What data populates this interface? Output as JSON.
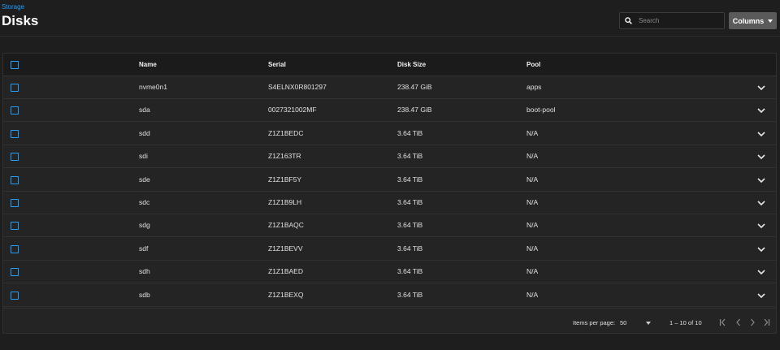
{
  "breadcrumb": "Storage",
  "title": "Disks",
  "search": {
    "placeholder": "Search",
    "value": ""
  },
  "columns_button": {
    "label": "Columns"
  },
  "table": {
    "headers": [
      "Name",
      "Serial",
      "Disk Size",
      "Pool"
    ],
    "rows": [
      {
        "name": "nvme0n1",
        "serial": "S4ELNX0R801297",
        "size": "238.47 GiB",
        "pool": "apps"
      },
      {
        "name": "sda",
        "serial": "0027321002MF",
        "size": "238.47 GiB",
        "pool": "boot-pool"
      },
      {
        "name": "sdd",
        "serial": "Z1Z1BEDC",
        "size": "3.64 TiB",
        "pool": "N/A"
      },
      {
        "name": "sdi",
        "serial": "Z1Z163TR",
        "size": "3.64 TiB",
        "pool": "N/A"
      },
      {
        "name": "sde",
        "serial": "Z1Z1BF5Y",
        "size": "3.64 TiB",
        "pool": "N/A"
      },
      {
        "name": "sdc",
        "serial": "Z1Z1B9LH",
        "size": "3.64 TiB",
        "pool": "N/A"
      },
      {
        "name": "sdg",
        "serial": "Z1Z1BAQC",
        "size": "3.64 TiB",
        "pool": "N/A"
      },
      {
        "name": "sdf",
        "serial": "Z1Z1BEVV",
        "size": "3.64 TiB",
        "pool": "N/A"
      },
      {
        "name": "sdh",
        "serial": "Z1Z1BAED",
        "size": "3.64 TiB",
        "pool": "N/A"
      },
      {
        "name": "sdb",
        "serial": "Z1Z1BEXQ",
        "size": "3.64 TiB",
        "pool": "N/A"
      }
    ]
  },
  "paginator": {
    "items_per_page_label": "Items per page:",
    "items_per_page": "50",
    "range": "1 – 10 of 10"
  },
  "colors": {
    "accent": "#1f9fff",
    "background": "#1e1e1e",
    "card": "#242424"
  }
}
